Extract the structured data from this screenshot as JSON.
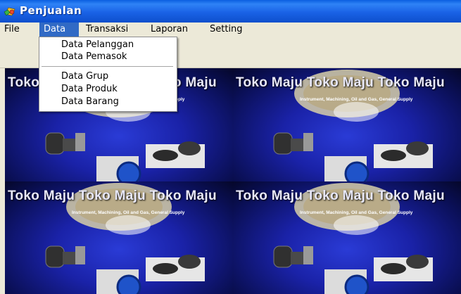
{
  "window": {
    "title": "Penjualan"
  },
  "menubar": {
    "items": [
      "File",
      "Data",
      "Transaksi",
      "Laporan",
      "Setting"
    ],
    "active_index": 1
  },
  "dropdown": {
    "items": [
      "Data Pelanggan",
      "Data Pemasok",
      "Data Grup",
      "Data Produk",
      "Data Barang"
    ]
  },
  "wallpaper": {
    "title": "Toko Maju",
    "subtitle": "Instrument, Machining, Oil and Gas, General Supply",
    "logo_text": "57"
  },
  "colors": {
    "titlebar": "#0a5fe0",
    "menu_highlight": "#316ac5",
    "background": "#ece9d8"
  }
}
